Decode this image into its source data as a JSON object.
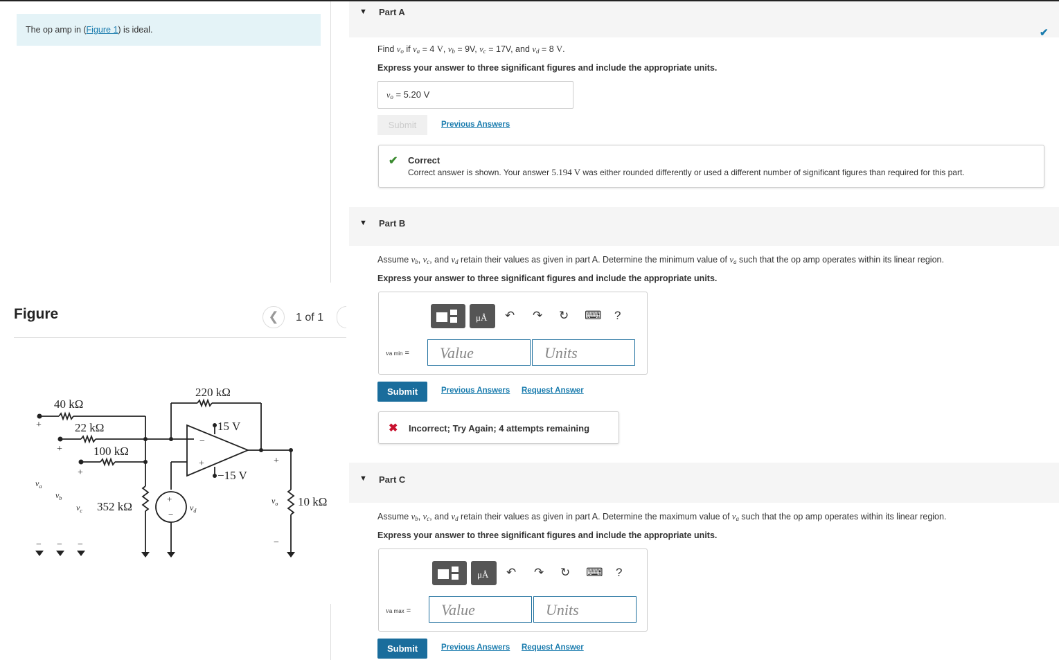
{
  "intro": {
    "before": "The op amp in (",
    "link": "Figure 1",
    "after": ") is ideal."
  },
  "figure": {
    "title": "Figure",
    "pager": "1 of 1"
  },
  "circuit": {
    "r40": "40 kΩ",
    "r22": "22 kΩ",
    "r100": "100 kΩ",
    "r352": "352 kΩ",
    "r220": "220 kΩ",
    "r10": "10 kΩ",
    "vpos": "15 V",
    "vneg": "−15 V",
    "plus": "+",
    "minus": "−"
  },
  "partA": {
    "title": "Part A",
    "question_pre": "Find ",
    "question_post": " if",
    "values_text": " = 4 V, ",
    "instr": "Express your answer to three significant figures and include the appropriate units.",
    "answer_label": " = ",
    "answer_value": "5.20 V",
    "submit": "Submit",
    "prev": "Previous Answers",
    "fb_head": "Correct",
    "fb_body_pre": "Correct answer is shown. Your answer ",
    "fb_body_val": "5.194 V",
    "fb_body_post": " was either rounded differently or used a different number of significant figures than required for this part."
  },
  "partB": {
    "title": "Part B",
    "q_pre": "Assume ",
    "q_mid": ", and ",
    "q_mid2": " retain their values as given in part A. Determine the minimum value of ",
    "q_post": " such that the op amp operates within its linear region.",
    "instr": "Express your answer to three significant figures and include the appropriate units.",
    "var": "v",
    "var_sub": "a min",
    "eq": " =",
    "value_ph": "Value",
    "units_ph": "Units",
    "submit": "Submit",
    "prev": "Previous Answers",
    "req": "Request Answer",
    "fb": "Incorrect; Try Again; 4 attempts remaining",
    "help": "?"
  },
  "partC": {
    "title": "Part C",
    "q_pre": "Assume ",
    "q_mid": ", and ",
    "q_mid2": " retain their values as given in part A. Determine the maximum value of ",
    "q_post": " such that the op amp operates within its linear region.",
    "instr": "Express your answer to three significant figures and include the appropriate units.",
    "var": "v",
    "var_sub": "a max",
    "eq": " =",
    "value_ph": "Value",
    "units_ph": "Units",
    "submit": "Submit",
    "prev": "Previous Answers",
    "req": "Request Answer",
    "help": "?"
  },
  "icons": {
    "collapse": "▼",
    "check": "✔",
    "cross": "✖",
    "undo": "↶",
    "redo": "↷",
    "reset": "↻",
    "keyboard": "⌨",
    "prev_page": "❮",
    "next_page": "❯"
  }
}
